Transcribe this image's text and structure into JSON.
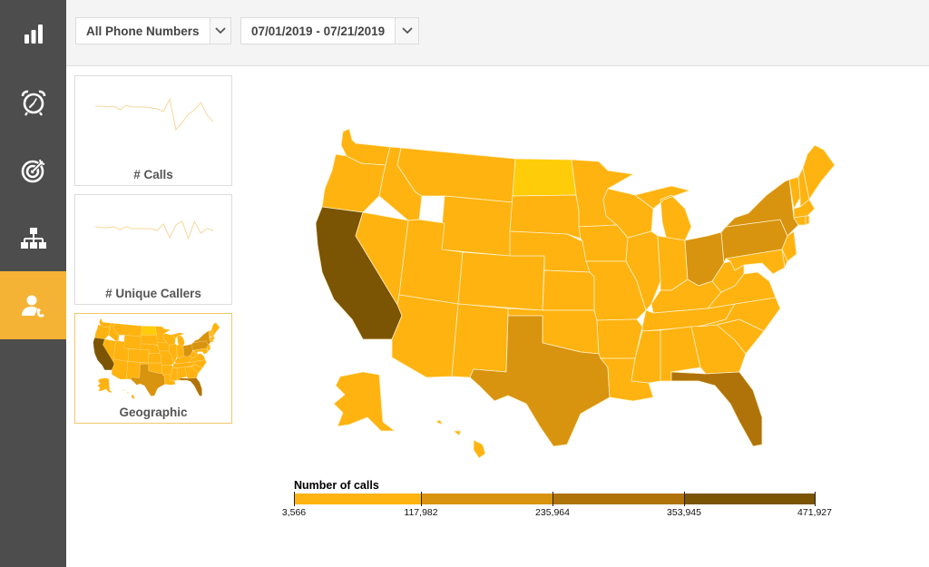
{
  "sidebar": {
    "items": [
      {
        "name": "reports",
        "icon": "bar-chart-icon",
        "active": false
      },
      {
        "name": "alarms",
        "icon": "alarm-clock-icon",
        "active": false
      },
      {
        "name": "goals",
        "icon": "target-icon",
        "active": false
      },
      {
        "name": "hierarchy",
        "icon": "org-chart-icon",
        "active": false
      },
      {
        "name": "callers",
        "icon": "user-phone-icon",
        "active": true
      }
    ],
    "accent": "#f5b335"
  },
  "filters": {
    "phone_numbers": "All Phone Numbers",
    "date_range": "07/01/2019 - 07/21/2019"
  },
  "cards": [
    {
      "title": "# Calls",
      "sparkline": [
        62,
        62,
        61,
        62,
        58,
        63,
        61,
        61,
        61,
        60,
        59,
        56,
        70,
        36,
        44,
        53,
        58,
        66,
        52,
        45
      ]
    },
    {
      "title": "# Unique Callers",
      "sparkline": [
        60,
        59,
        59,
        60,
        57,
        60,
        58,
        58,
        58,
        58,
        56,
        63,
        48,
        62,
        66,
        47,
        66,
        53,
        58,
        56
      ]
    },
    {
      "title": "Geographic",
      "active": true
    }
  ],
  "chart_data": {
    "type": "heatmap",
    "title": "Number of calls",
    "legend_ticks": [
      "3,566",
      "117,982",
      "235,964",
      "353,945",
      "471,927"
    ],
    "legend_colors": [
      "#ffb310",
      "#d8930f",
      "#b0730a",
      "#7b5404"
    ],
    "highlight_color": "#ffcc0a",
    "states": {
      "CA": {
        "bucket": 3,
        "approx_calls": 471927
      },
      "FL": {
        "bucket": 2,
        "approx_calls": 300000
      },
      "TX": {
        "bucket": 1,
        "approx_calls": 200000
      },
      "NY": {
        "bucket": 1,
        "approx_calls": 180000
      },
      "PA": {
        "bucket": 1,
        "approx_calls": 160000
      },
      "OH": {
        "bucket": 1,
        "approx_calls": 140000
      },
      "ND": {
        "bucket": -1,
        "approx_calls": 3566
      },
      "other": {
        "bucket": 0
      }
    }
  }
}
